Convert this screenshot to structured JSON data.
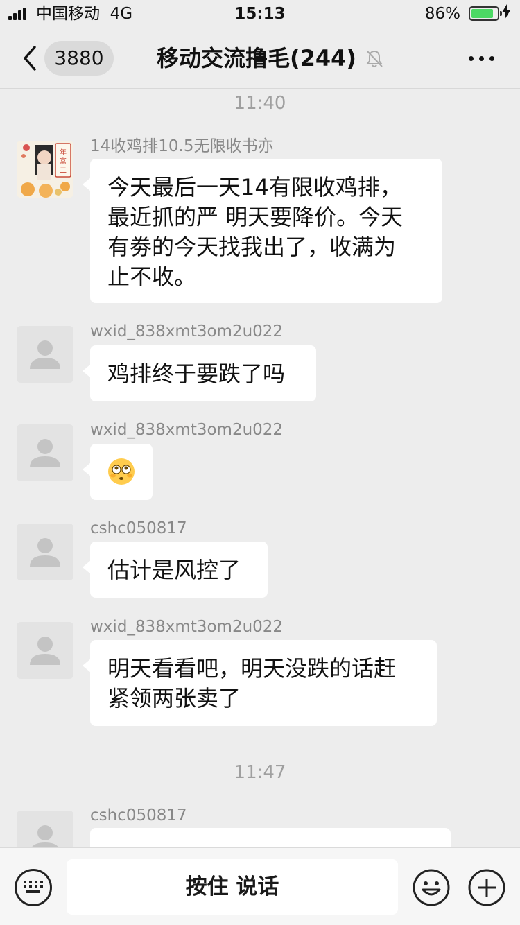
{
  "status_bar": {
    "carrier": "中国移动",
    "network": "4G",
    "time": "15:13",
    "battery_percent": "86%",
    "battery_level": 0.86
  },
  "nav": {
    "unread_count": "3880",
    "title": "移动交流撸毛(244)",
    "icons": {
      "back": "chevron-left-icon",
      "mute": "bell-off-icon",
      "more": "more-dots-icon"
    }
  },
  "chat": {
    "time_1": "11:40",
    "time_2": "11:47",
    "messages": [
      {
        "sender": "14收鸡排10.5无限收书亦",
        "lines": [
          "今天最后一天14有限收鸡排，",
          "最近抓的严 明天要降价。今天",
          "有劵的今天找我出了，收满为",
          "止不收。"
        ]
      },
      {
        "sender": "wxid_838xmt3om2u022",
        "text": "鸡排终于要跌了吗"
      },
      {
        "sender": "wxid_838xmt3om2u022",
        "emoji": "flushed-face-emoji"
      },
      {
        "sender": "cshc050817",
        "text": "估计是风控了"
      },
      {
        "sender": "wxid_838xmt3om2u022",
        "lines": [
          "明天看看吧，明天没跌的话赶",
          "紧领两张卖了"
        ]
      },
      {
        "sender": "cshc050817"
      }
    ]
  },
  "input_bar": {
    "hold_to_talk": "按住 说话",
    "icons": {
      "keyboard": "keyboard-icon",
      "emoji": "emoji-icon",
      "plus": "plus-icon"
    }
  },
  "colors": {
    "background": "#ededed",
    "bubble": "#ffffff",
    "battery_fill": "#4cd964",
    "meta_text": "#888888"
  }
}
